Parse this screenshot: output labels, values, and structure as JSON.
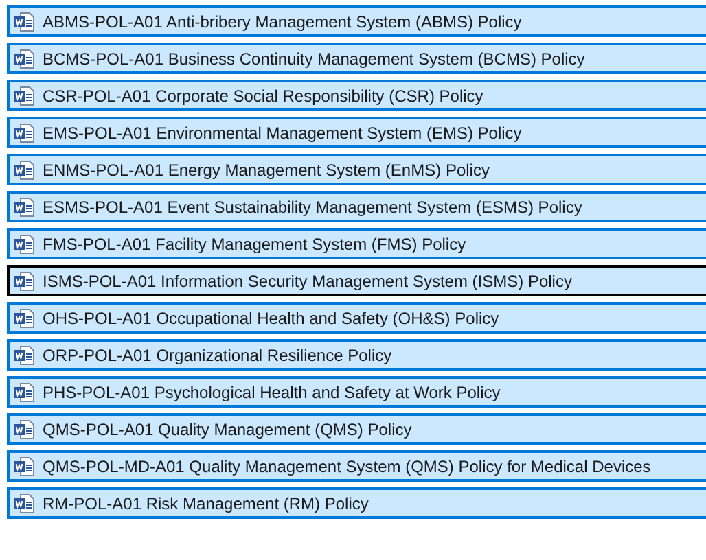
{
  "files": [
    {
      "name": "ABMS-POL-A01 Anti-bribery Management System (ABMS) Policy",
      "selected": true,
      "focused": false
    },
    {
      "name": "BCMS-POL-A01 Business Continuity Management System (BCMS) Policy",
      "selected": true,
      "focused": false
    },
    {
      "name": "CSR-POL-A01 Corporate Social Responsibility (CSR) Policy",
      "selected": true,
      "focused": false
    },
    {
      "name": "EMS-POL-A01 Environmental Management System (EMS) Policy",
      "selected": true,
      "focused": false
    },
    {
      "name": "ENMS-POL-A01 Energy Management System (EnMS) Policy",
      "selected": true,
      "focused": false
    },
    {
      "name": "ESMS-POL-A01 Event Sustainability Management System (ESMS) Policy",
      "selected": true,
      "focused": false
    },
    {
      "name": "FMS-POL-A01 Facility Management System (FMS) Policy",
      "selected": true,
      "focused": false
    },
    {
      "name": "ISMS-POL-A01 Information Security Management System (ISMS) Policy",
      "selected": true,
      "focused": true
    },
    {
      "name": "OHS-POL-A01 Occupational Health and Safety (OH&S) Policy",
      "selected": true,
      "focused": false
    },
    {
      "name": "ORP-POL-A01 Organizational Resilience Policy",
      "selected": true,
      "focused": false
    },
    {
      "name": "PHS-POL-A01 Psychological Health and Safety at Work Policy",
      "selected": true,
      "focused": false
    },
    {
      "name": "QMS-POL-A01 Quality Management (QMS) Policy",
      "selected": true,
      "focused": false
    },
    {
      "name": "QMS-POL-MD-A01 Quality Management System (QMS) Policy for Medical Devices",
      "selected": true,
      "focused": false
    },
    {
      "name": "RM-POL-A01 Risk Management (RM) Policy",
      "selected": true,
      "focused": false
    }
  ]
}
